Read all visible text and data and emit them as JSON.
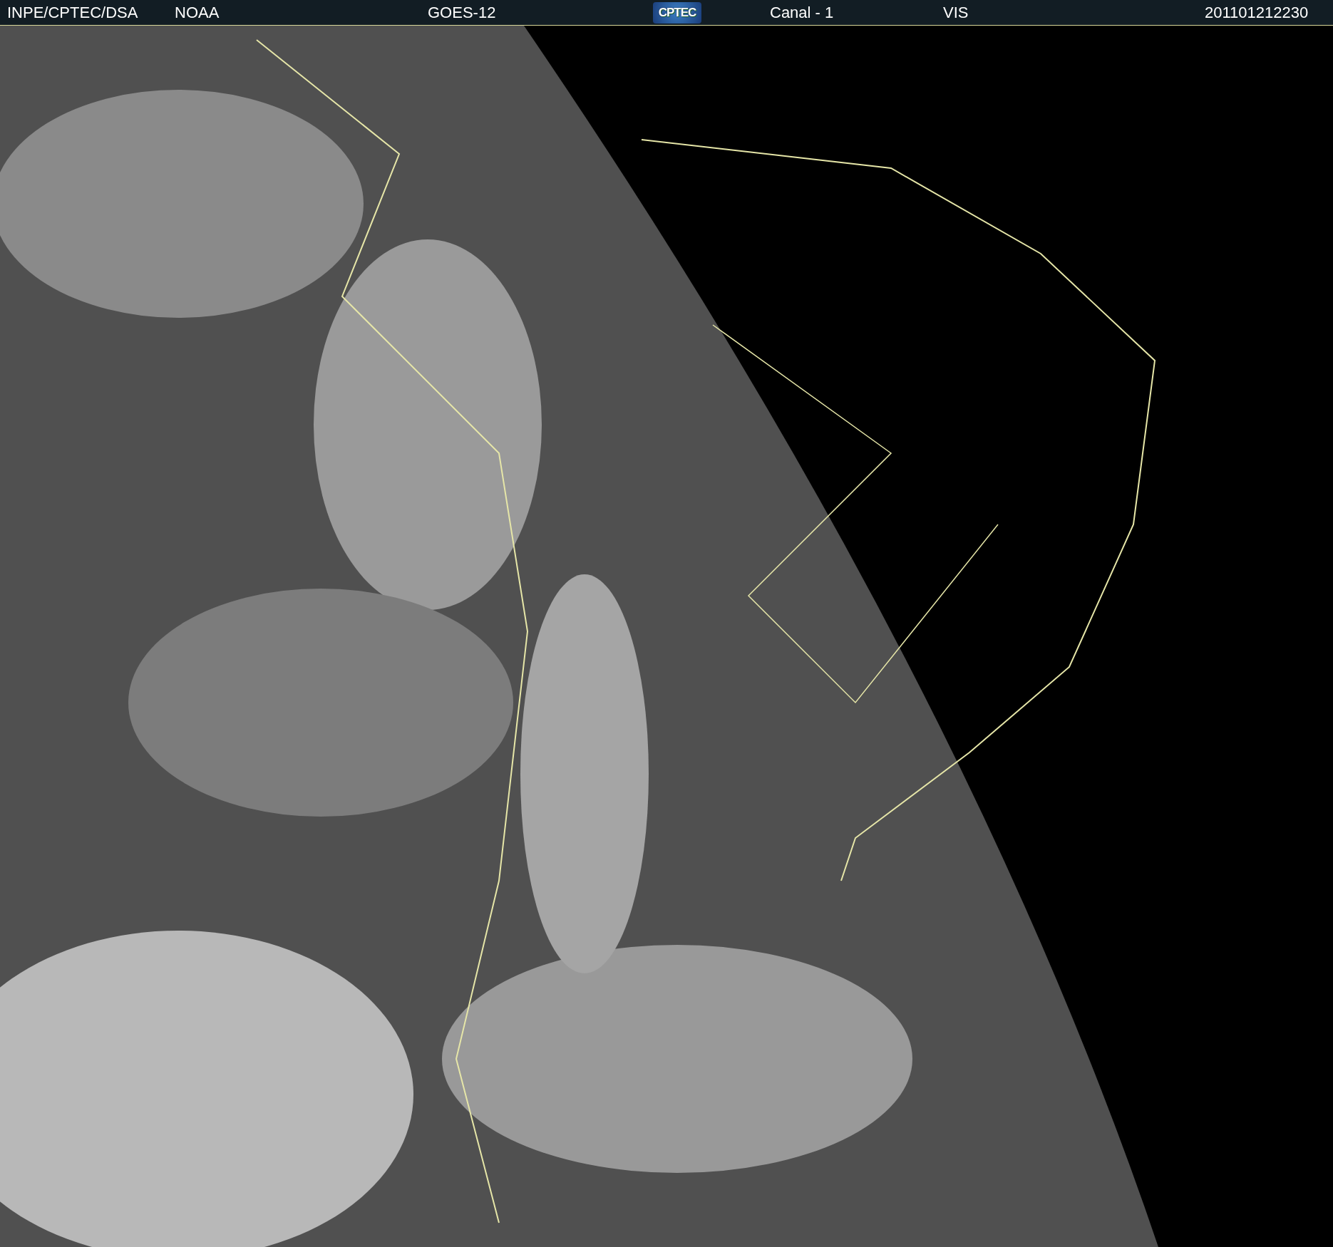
{
  "header": {
    "source": "INPE/CPTEC/DSA",
    "agency": "NOAA",
    "satellite": "GOES-12",
    "logo_text": "CPTEC",
    "channel": "Canal - 1",
    "band": "VIS",
    "timestamp": "201101212230"
  }
}
